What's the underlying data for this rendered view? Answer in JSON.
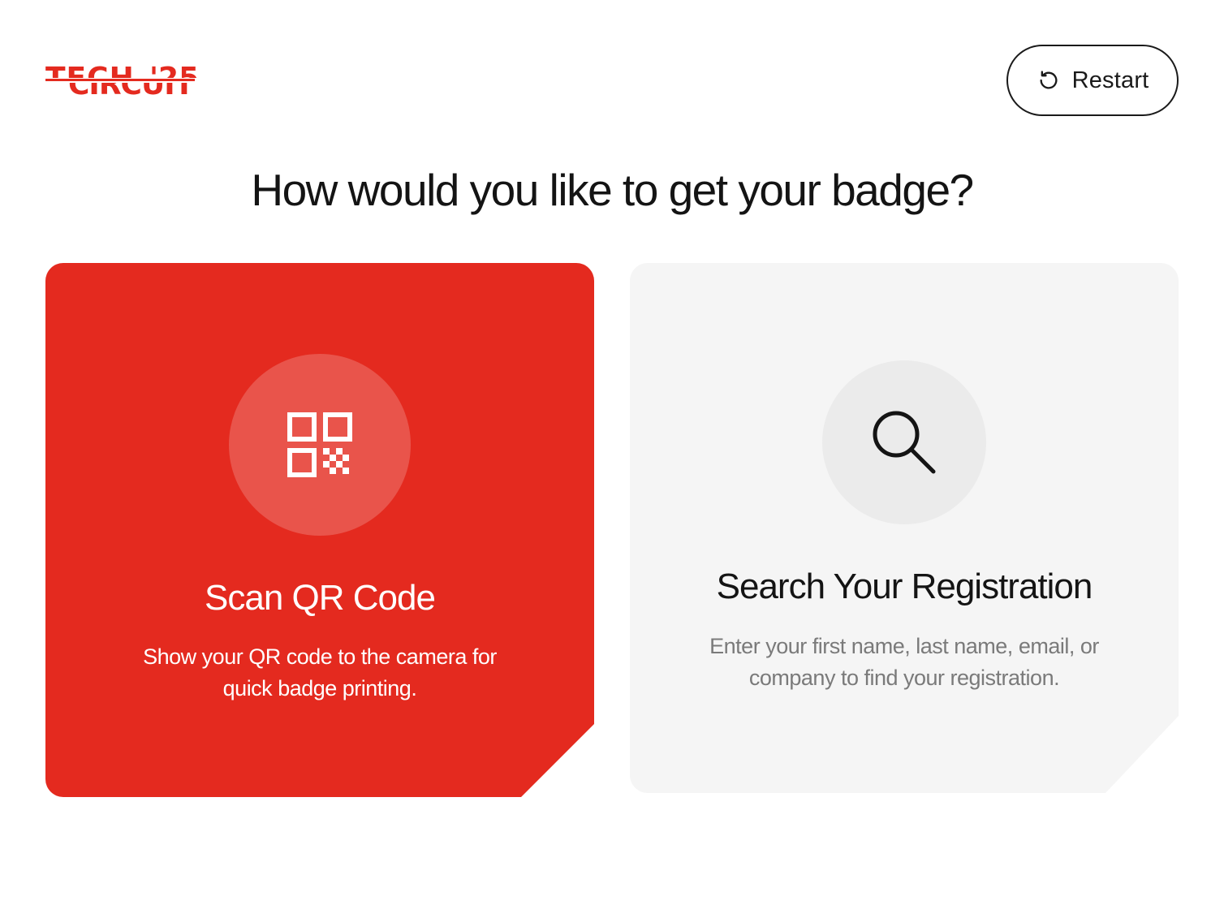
{
  "header": {
    "logo_text": "TECH '25 CIRCUIT",
    "logo_icon": "tech-circuit-logo",
    "restart_label": "Restart",
    "restart_icon": "restart-icon"
  },
  "main": {
    "title": "How would you like to get your badge?",
    "options": [
      {
        "title": "Scan QR Code",
        "description": "Show your QR code to the camera for quick badge printing.",
        "icon": "qr-code-icon",
        "selected": true
      },
      {
        "title": "Search Your Registration",
        "description": "Enter your first name, last name, email, or company to find your registration.",
        "icon": "search-icon",
        "selected": false
      }
    ]
  },
  "colors": {
    "accent": "#e42a1f",
    "card_inactive": "#f5f5f5",
    "text_dark": "#141414",
    "text_muted": "#7a7a7a"
  }
}
